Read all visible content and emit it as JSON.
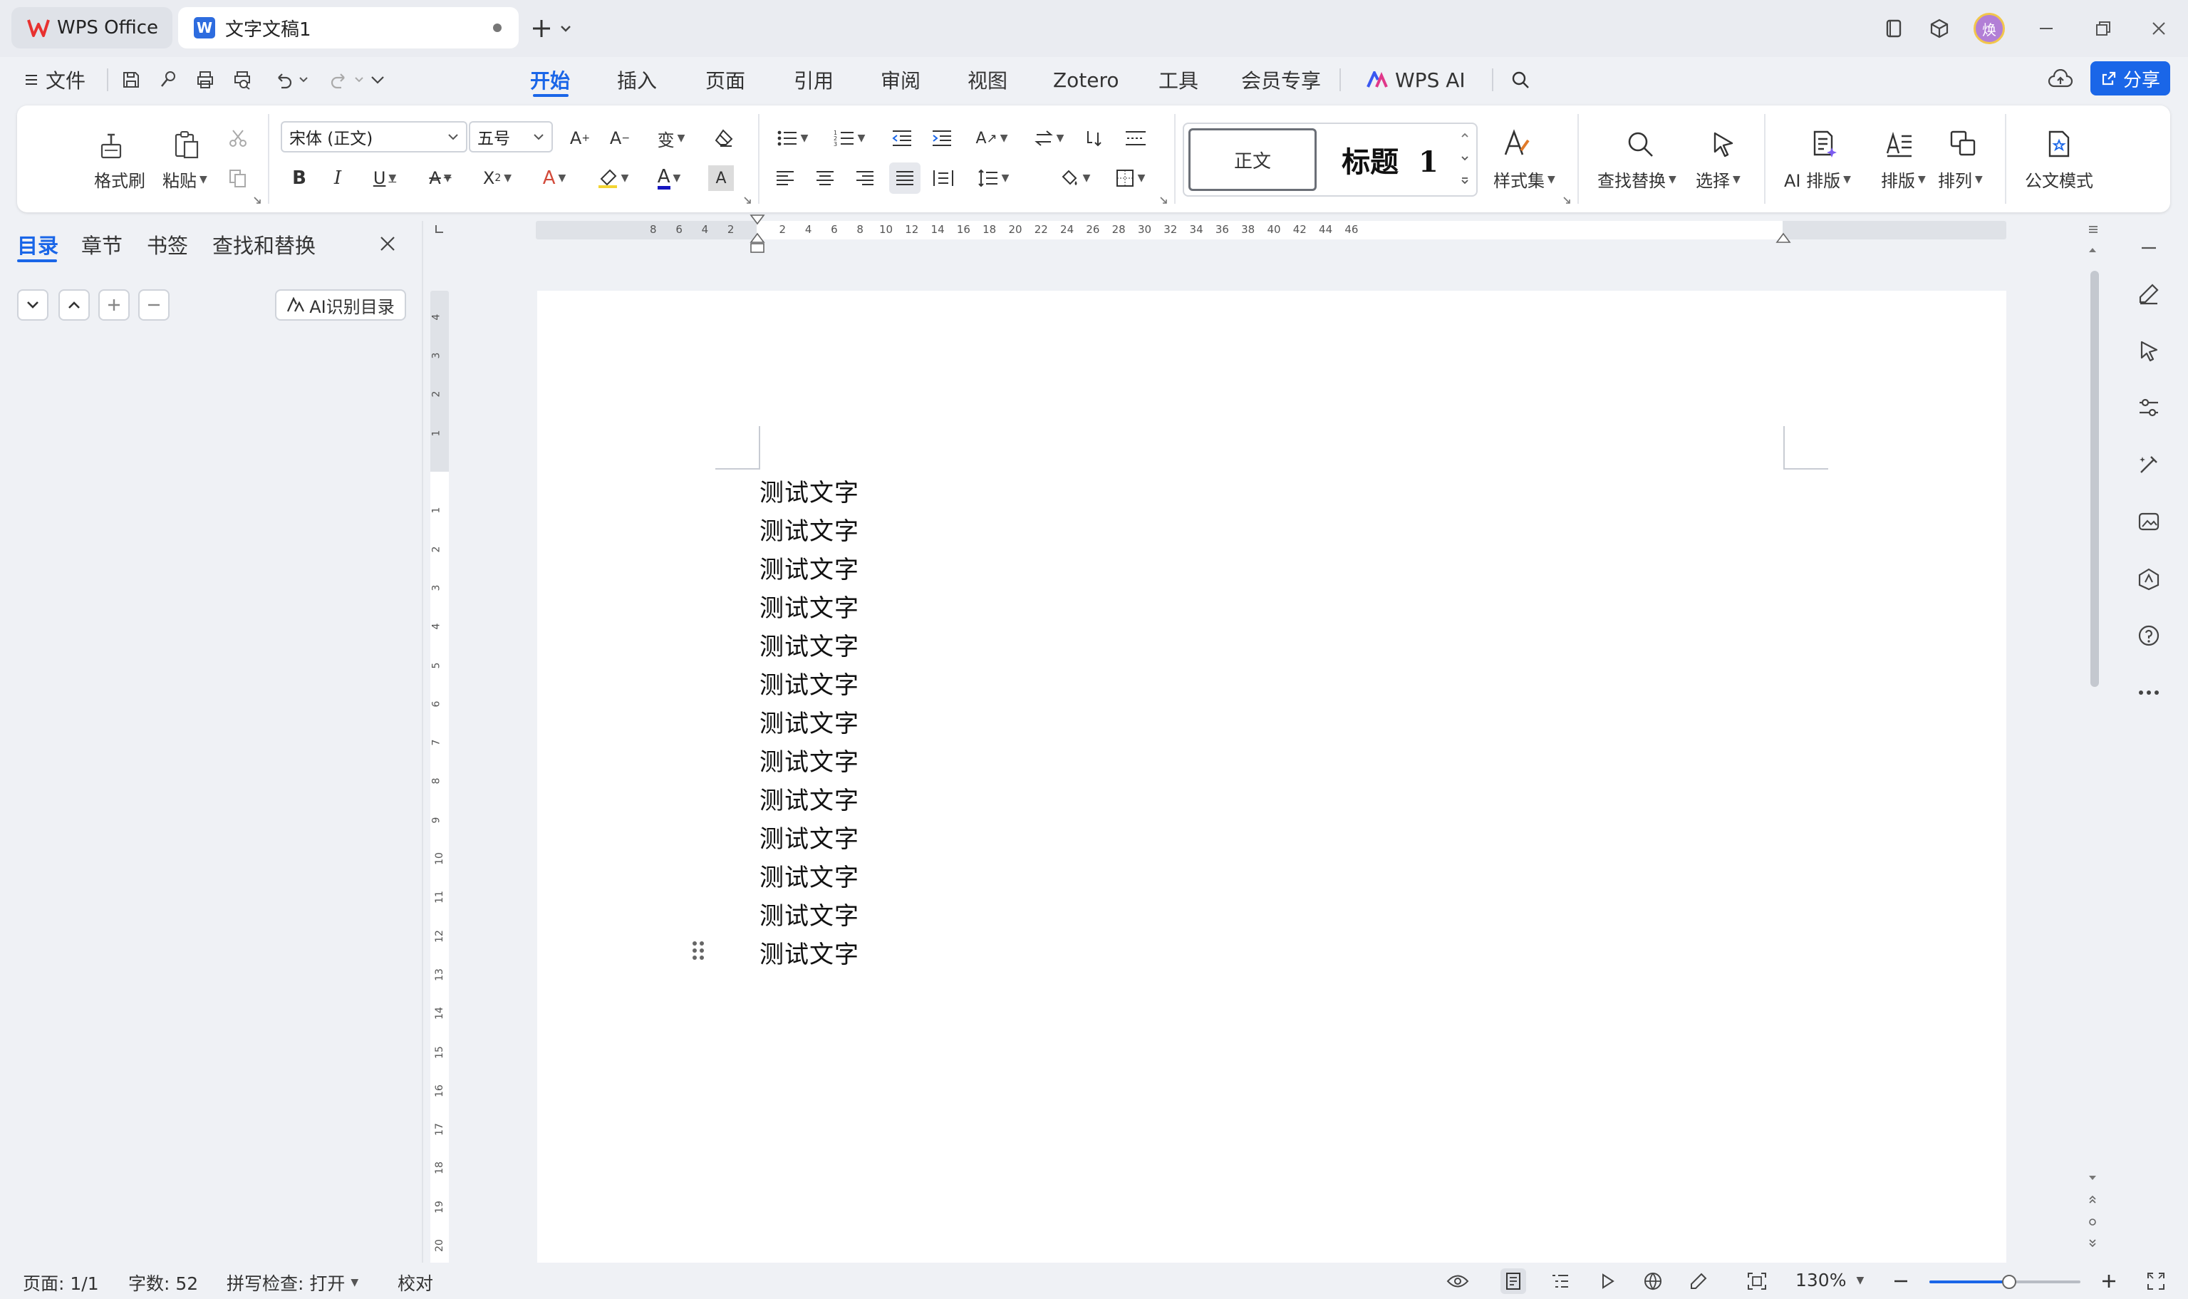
{
  "titlebar": {
    "app_tab": "WPS Office",
    "doc_tab": "文字文稿1",
    "avatar_text": "焕"
  },
  "menu": {
    "file": "文件",
    "tabs": [
      "开始",
      "插入",
      "页面",
      "引用",
      "审阅",
      "视图",
      "Zotero",
      "工具",
      "会员专享"
    ],
    "wps_ai": "WPS AI",
    "share": "分享"
  },
  "ribbon": {
    "format_painter": "格式刷",
    "paste": "粘贴",
    "font_name": "宋体 (正文)",
    "font_size": "五号",
    "style_normal": "正文",
    "style_heading": "标题  1",
    "style_set": "样式集",
    "find_replace": "查找替换",
    "select": "选择",
    "ai_layout": "AI 排版",
    "layout": "排版",
    "arrange": "排列",
    "official_mode": "公文模式"
  },
  "panel": {
    "tabs": [
      "目录",
      "章节",
      "书签",
      "查找和替换"
    ],
    "ai_toc": "AI识别目录"
  },
  "ruler": {
    "h_ticks": [
      "8",
      "6",
      "4",
      "2",
      "2",
      "4",
      "6",
      "8",
      "10",
      "12",
      "14",
      "16",
      "18",
      "20",
      "22",
      "24",
      "26",
      "28",
      "30",
      "32",
      "34",
      "36",
      "38",
      "40",
      "42",
      "44",
      "46"
    ],
    "v_ticks_top": [
      "4",
      "3",
      "2",
      "1"
    ],
    "v_ticks": [
      "1",
      "2",
      "3",
      "4",
      "5",
      "6",
      "7",
      "8",
      "9",
      "10",
      "11",
      "12",
      "13",
      "14",
      "15",
      "16",
      "17",
      "18",
      "19",
      "20"
    ]
  },
  "document": {
    "lines": [
      "测试文字",
      "测试文字",
      "测试文字",
      "测试文字",
      "测试文字",
      "测试文字",
      "测试文字",
      "测试文字",
      "测试文字",
      "测试文字",
      "测试文字",
      "测试文字",
      "测试文字"
    ]
  },
  "status": {
    "page": "页面: 1/1",
    "word_count": "字数: 52",
    "spell_check": "拼写检查: 打开",
    "proofread": "校对",
    "zoom": "130%",
    "zoom_fraction": 0.53
  },
  "colors": {
    "accent": "#1a66e8",
    "wps_red": "#e8312f"
  }
}
